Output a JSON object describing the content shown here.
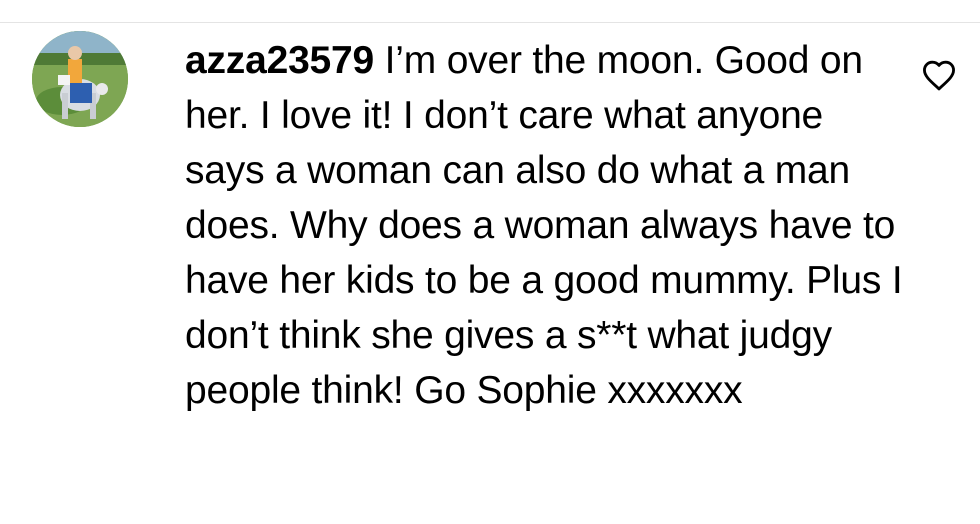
{
  "comment": {
    "username": "azza23579",
    "text": "I’m over the moon. Good on her. I love it! I don’t care what anyone says a woman can also do what a man does. Why does a woman always have to have her kids to be a good mummy. Plus I don’t think she gives a s**t what judgy people think! Go Sophie xxxxxxx",
    "avatar_icon": "user-avatar-photo",
    "like_icon": "heart-outline-icon"
  },
  "colors": {
    "text": "#000000",
    "divider": "#e4e4e4",
    "background": "#ffffff"
  }
}
